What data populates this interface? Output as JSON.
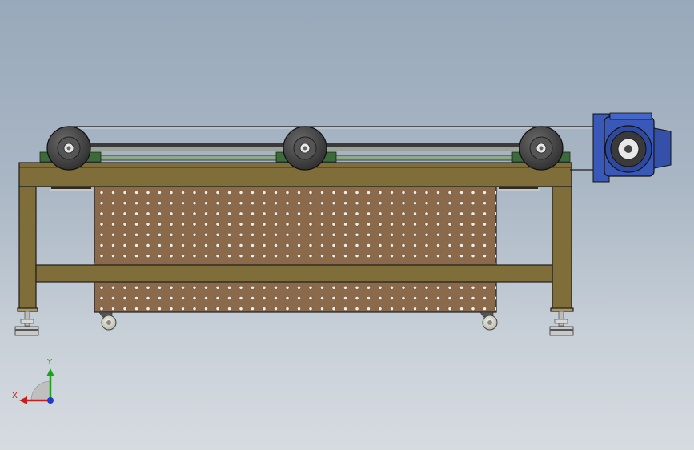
{
  "view": {
    "background_top": "#98a9bb",
    "background_bottom": "#d6dbe0"
  },
  "model": {
    "frame_color": "#7f6d3a",
    "panel_color": "#8a6a4a",
    "motor_color": "#3a58b8",
    "pulley_color": "#4a4a4a",
    "rail_color": "#3d6a3a"
  },
  "triad": {
    "x_label": "X",
    "y_label": "Y",
    "x_color": "#c81e1e",
    "y_color": "#1ea01e",
    "z_color": "#1e3cc8"
  }
}
